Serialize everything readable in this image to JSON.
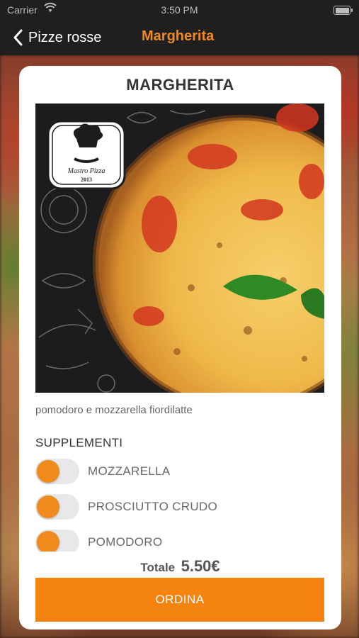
{
  "status_bar": {
    "carrier": "Carrier",
    "time": "3:50 PM"
  },
  "nav": {
    "back_label": "Pizze rosse",
    "title": "Margherita"
  },
  "product": {
    "name": "MARGHERITA",
    "logo_text": "Mastro Pizza",
    "logo_year": "2013",
    "description": "pomodoro e mozzarella fiordilatte"
  },
  "supplements": {
    "title": "SUPPLEMENTI",
    "items": [
      {
        "label": "MOZZARELLA",
        "enabled": false
      },
      {
        "label": "PROSCIUTTO CRUDO",
        "enabled": false
      },
      {
        "label": "POMODORO",
        "enabled": false
      }
    ]
  },
  "total": {
    "label": "Totale",
    "amount": "5.50€"
  },
  "order_button": {
    "label": "ORDINA"
  },
  "colors": {
    "accent": "#f08a1c",
    "button": "#f5830f",
    "nav_bg": "#1f1f1f"
  }
}
